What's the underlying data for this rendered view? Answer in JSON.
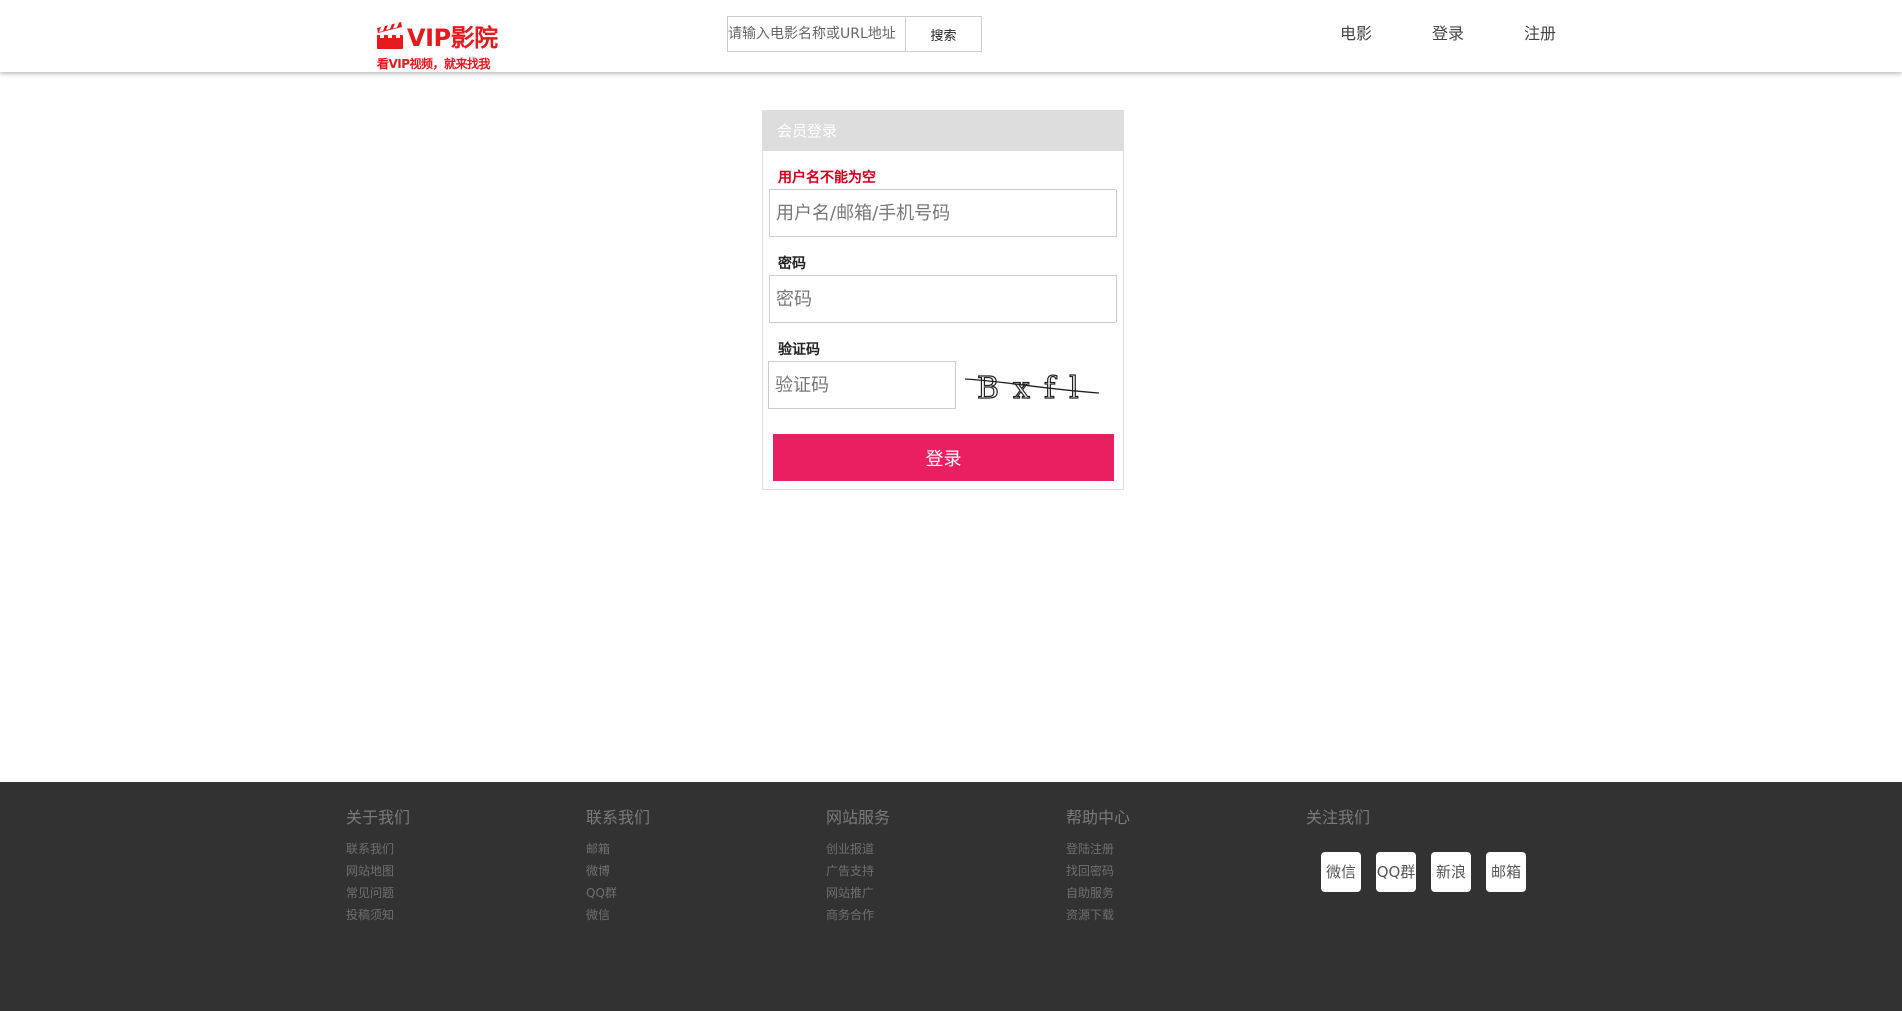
{
  "logo": {
    "title": "VIP影院",
    "slogan": "看VIP视频，就来找我",
    "icon": "clapperboard-icon",
    "color": "#e8191d"
  },
  "search": {
    "placeholder": "请输入电影名称或URL地址",
    "button_label": "搜索"
  },
  "nav": {
    "items": [
      "电影",
      "登录",
      "注册"
    ]
  },
  "login": {
    "title": "会员登录",
    "username_error": "用户名不能为空",
    "username_placeholder": "用户名/邮箱/手机号码",
    "password_label": "密码",
    "password_placeholder": "密码",
    "captcha_label": "验证码",
    "captcha_placeholder": "验证码",
    "captcha_text": "Bxfl",
    "submit_label": "登录",
    "accent_color": "#ea1f61",
    "error_color": "#d1001c"
  },
  "footer": {
    "columns": [
      {
        "title": "关于我们",
        "links": [
          "联系我们",
          "网站地图",
          "常见问题",
          "投稿须知"
        ]
      },
      {
        "title": "联系我们",
        "links": [
          "邮箱",
          "微博",
          "QQ群",
          "微信"
        ]
      },
      {
        "title": "网站服务",
        "links": [
          "创业报道",
          "广告支持",
          "网站推广",
          "商务合作"
        ]
      },
      {
        "title": "帮助中心",
        "links": [
          "登陆注册",
          "找回密码",
          "自助服务",
          "资源下载"
        ]
      },
      {
        "title": "关注我们",
        "links": []
      }
    ],
    "social": [
      "微信",
      "QQ群",
      "新浪",
      "邮箱"
    ],
    "background": "#323232"
  }
}
